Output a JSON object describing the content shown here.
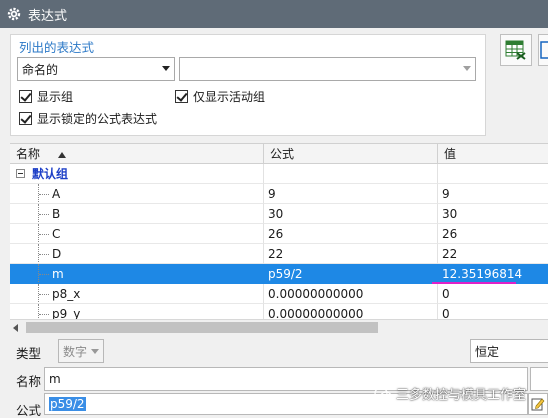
{
  "window": {
    "title": "表达式"
  },
  "list_panel": {
    "title": "列出的表达式",
    "filter_select": "命名的",
    "filter_text": "",
    "checkboxes": [
      {
        "label": "显示组",
        "checked": true
      },
      {
        "label": "仅显示活动组",
        "checked": true
      },
      {
        "label": "显示锁定的公式表达式",
        "checked": true
      }
    ]
  },
  "toolbar": {
    "icons": [
      "spreadsheet-icon",
      "partial-icon"
    ]
  },
  "table": {
    "columns": [
      "名称",
      "公式",
      "值"
    ],
    "sort": "ascending",
    "group": "默认组",
    "rows": [
      {
        "name": "A",
        "formula": "9",
        "value": "9"
      },
      {
        "name": "B",
        "formula": "30",
        "value": "30"
      },
      {
        "name": "C",
        "formula": "26",
        "value": "26"
      },
      {
        "name": "D",
        "formula": "22",
        "value": "22"
      },
      {
        "name": "m",
        "formula": "p59/2",
        "value": "12.35196814",
        "selected": true
      },
      {
        "name": "p8_x",
        "formula": "0.00000000000",
        "value": "0"
      },
      {
        "name": "p9_y",
        "formula": "0.00000000000",
        "value": "0"
      }
    ]
  },
  "editor": {
    "type_label": "类型",
    "type_value": "数字",
    "unit_value": "恒定",
    "name_label": "名称",
    "name_value": "m",
    "formula_label": "公式",
    "formula_value": "p59/2"
  },
  "watermark": "三多数控与模具工作室",
  "colors": {
    "titlebar": "#5f6b77",
    "selection": "#1e88e5",
    "group": "#1d3fc7",
    "annotation": "#e020c8",
    "section_title": "#2c79c7"
  }
}
